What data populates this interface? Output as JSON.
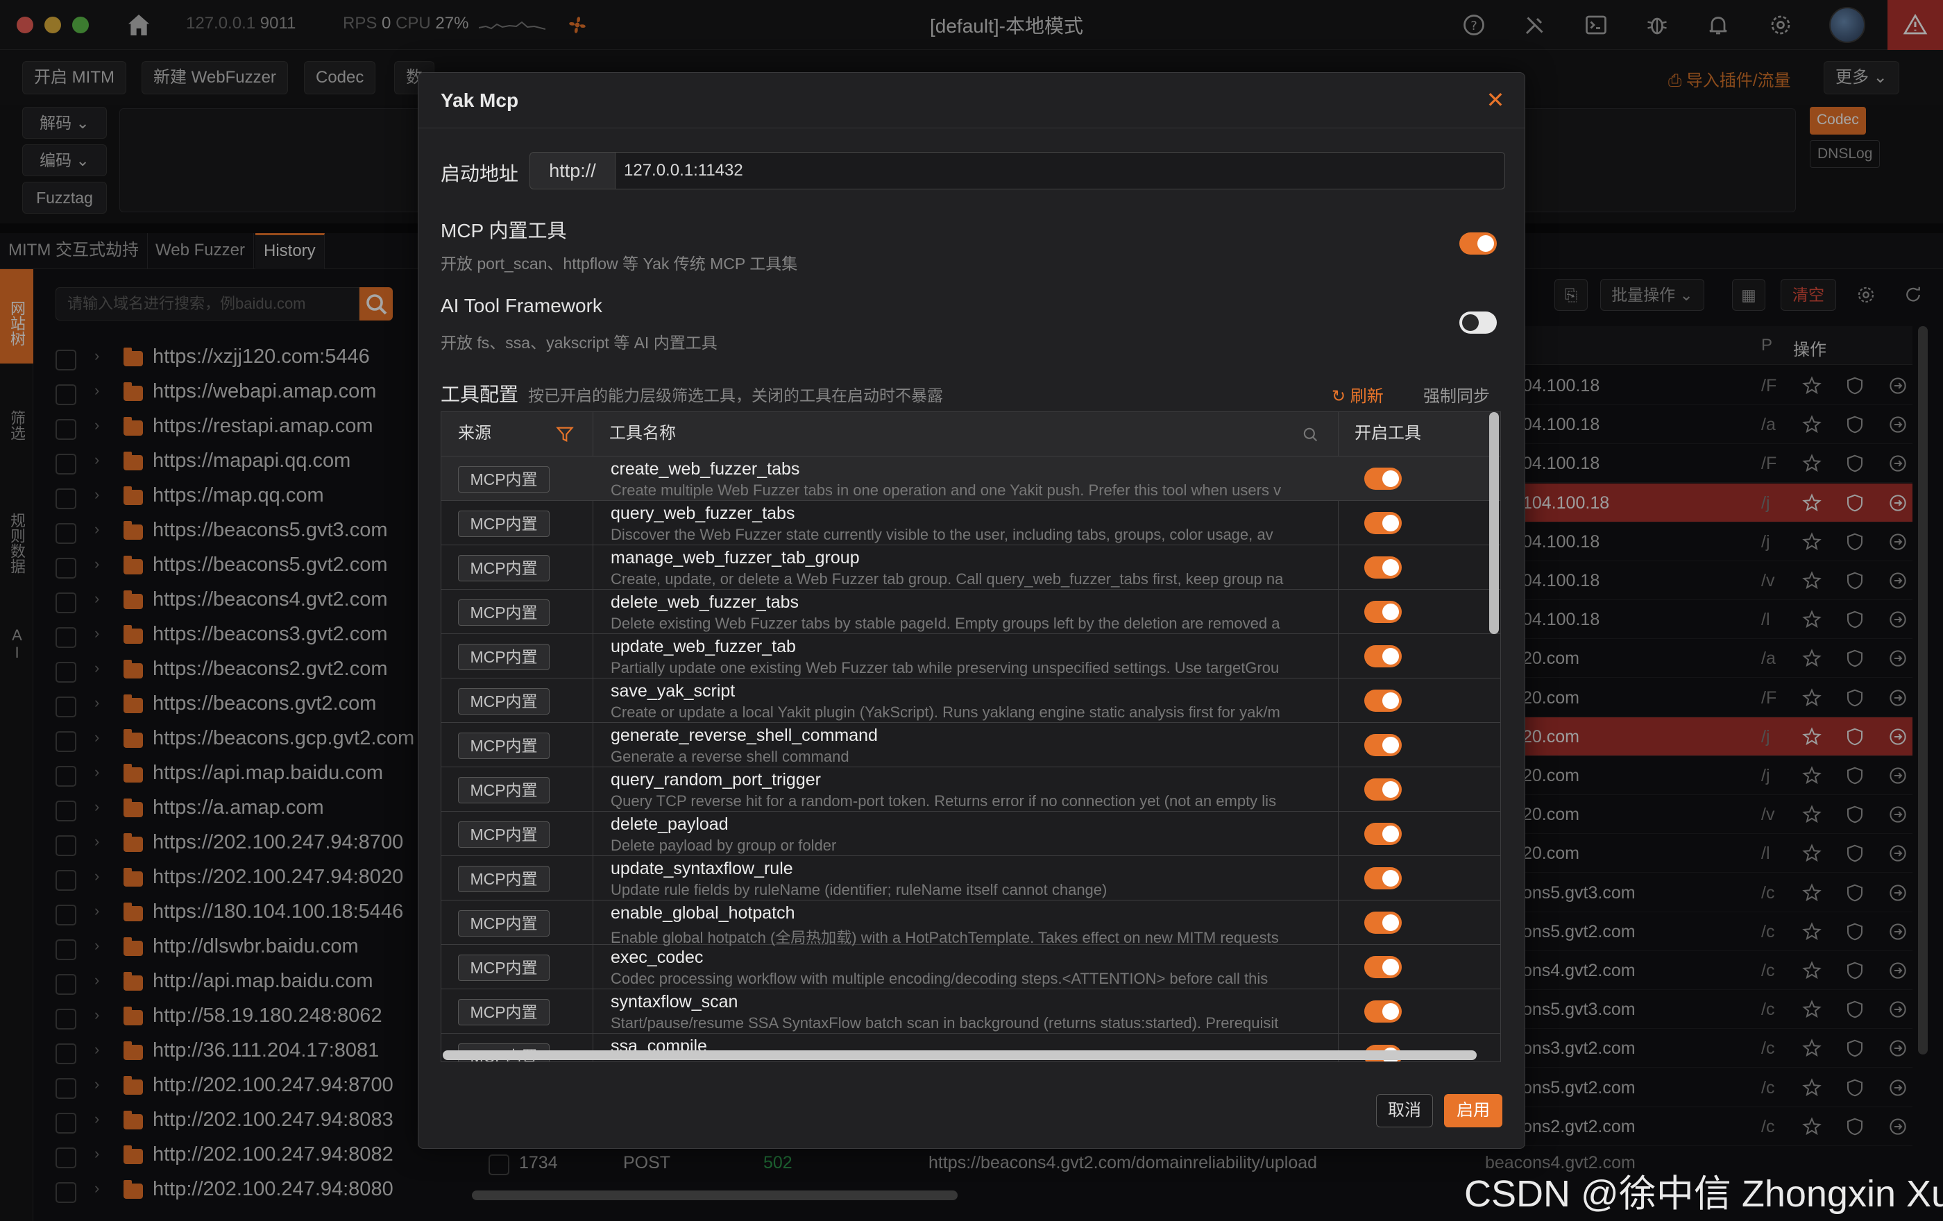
{
  "window": {
    "title": "[default]-本地模式",
    "address": "127.0.0.1",
    "port": "9011",
    "rps_label": "RPS",
    "rps_value": "0",
    "cpu_label": "CPU",
    "cpu_value": "27%"
  },
  "toolbar": {
    "buttons": [
      "开启 MITM",
      "新建 WebFuzzer",
      "Codec",
      "数"
    ],
    "import_label": "导入插件/流量",
    "more_label": "更多"
  },
  "codec": {
    "decode_label": "解码",
    "encode_label": "编码",
    "fuzztag_label": "Fuzztag",
    "right_tabs": [
      "Codec",
      "DNSLog"
    ]
  },
  "tabs": [
    "MITM 交互式劫持",
    "Web Fuzzer",
    "History"
  ],
  "left_rail": [
    "网站树",
    "筛选",
    "规则数据",
    "AI"
  ],
  "site_tree": {
    "search_placeholder": "请输入域名进行搜索，例baidu.com",
    "items": [
      "https://xzjj120.com:5446",
      "https://webapi.amap.com",
      "https://restapi.amap.com",
      "https://mapapi.qq.com",
      "https://map.qq.com",
      "https://beacons5.gvt3.com",
      "https://beacons5.gvt2.com",
      "https://beacons4.gvt2.com",
      "https://beacons3.gvt2.com",
      "https://beacons2.gvt2.com",
      "https://beacons.gvt2.com",
      "https://beacons.gcp.gvt2.com",
      "https://api.map.baidu.com",
      "https://a.amap.com",
      "https://202.100.247.94:8700",
      "https://202.100.247.94:8020",
      "https://180.104.100.18:5446",
      "http://dlswbr.baidu.com",
      "http://api.map.baidu.com",
      "http://58.19.180.248:8062",
      "http://36.111.204.17:8081",
      "http://202.100.247.94:8700",
      "http://202.100.247.94:8083",
      "http://202.100.247.94:8082",
      "http://202.100.247.94:8080"
    ]
  },
  "history": {
    "batch_label": "批量操作",
    "clear_label": "清空",
    "col_p": "P",
    "col_ops": "操作",
    "rows": [
      {
        "host": "04.100.18",
        "path": "/F",
        "hl": false
      },
      {
        "host": "04.100.18",
        "path": "/a",
        "hl": false
      },
      {
        "host": "04.100.18",
        "path": "/F",
        "hl": false
      },
      {
        "host": "104.100.18",
        "path": "/j",
        "hl": true
      },
      {
        "host": "04.100.18",
        "path": "/j",
        "hl": false
      },
      {
        "host": "04.100.18",
        "path": "/v",
        "hl": false
      },
      {
        "host": "04.100.18",
        "path": "/l",
        "hl": false
      },
      {
        "host": "20.com",
        "path": "/a",
        "hl": false
      },
      {
        "host": "20.com",
        "path": "/F",
        "hl": false
      },
      {
        "host": "20.com",
        "path": "/j",
        "hl": true
      },
      {
        "host": "20.com",
        "path": "/j",
        "hl": false
      },
      {
        "host": "20.com",
        "path": "/v",
        "hl": false
      },
      {
        "host": "20.com",
        "path": "/l",
        "hl": false
      },
      {
        "host": "ons5.gvt3.com",
        "path": "/c",
        "hl": false
      },
      {
        "host": "ons5.gvt2.com",
        "path": "/c",
        "hl": false
      },
      {
        "host": "ons4.gvt2.com",
        "path": "/c",
        "hl": false
      },
      {
        "host": "ons5.gvt3.com",
        "path": "/c",
        "hl": false
      },
      {
        "host": "ons3.gvt2.com",
        "path": "/c",
        "hl": false
      },
      {
        "host": "ons5.gvt2.com",
        "path": "/c",
        "hl": false
      },
      {
        "host": "ons2.gvt2.com",
        "path": "/c",
        "hl": false
      }
    ],
    "bottom_row": {
      "id": "1734",
      "method": "POST",
      "status": "502",
      "url": "https://beacons4.gvt2.com/domainreliability/upload",
      "host": "beacons4.gvt2.com"
    }
  },
  "modal": {
    "title": "Yak Mcp",
    "address_label": "启动地址",
    "address_prefix": "http://",
    "address_value": "127.0.0.1:11432",
    "builtin_title": "MCP 内置工具",
    "builtin_desc": "开放 port_scan、httpflow 等 Yak 传统 MCP 工具集",
    "builtin_enabled": true,
    "ai_title": "AI Tool Framework",
    "ai_desc": "开放 fs、ssa、yakscript 等 AI 内置工具",
    "ai_enabled": false,
    "config_title": "工具配置",
    "config_desc": "按已开启的能力层级筛选工具，关闭的工具在启动时不暴露",
    "refresh_label": "刷新",
    "sync_label": "强制同步",
    "col_source": "来源",
    "col_name": "工具名称",
    "col_enable": "开启工具",
    "cancel_label": "取消",
    "ok_label": "启用",
    "tools": [
      {
        "source": "MCP内置",
        "name": "create_web_fuzzer_tabs",
        "desc": "Create multiple Web Fuzzer tabs in one operation and one Yakit push. Prefer this tool when users v",
        "enabled": true
      },
      {
        "source": "MCP内置",
        "name": "query_web_fuzzer_tabs",
        "desc": "Discover the Web Fuzzer state currently visible to the user, including tabs, groups, color usage, av",
        "enabled": true
      },
      {
        "source": "MCP内置",
        "name": "manage_web_fuzzer_tab_group",
        "desc": "Create, update, or delete a Web Fuzzer tab group. Call query_web_fuzzer_tabs first, keep group na",
        "enabled": true
      },
      {
        "source": "MCP内置",
        "name": "delete_web_fuzzer_tabs",
        "desc": "Delete existing Web Fuzzer tabs by stable pageId. Empty groups left by the deletion are removed a",
        "enabled": true
      },
      {
        "source": "MCP内置",
        "name": "update_web_fuzzer_tab",
        "desc": "Partially update one existing Web Fuzzer tab while preserving unspecified settings. Use targetGrou",
        "enabled": true
      },
      {
        "source": "MCP内置",
        "name": "save_yak_script",
        "desc": "Create or update a local Yakit plugin (YakScript). Runs yaklang engine static analysis first for yak/m",
        "enabled": true
      },
      {
        "source": "MCP内置",
        "name": "generate_reverse_shell_command",
        "desc": "Generate a reverse shell command",
        "enabled": true
      },
      {
        "source": "MCP内置",
        "name": "query_random_port_trigger",
        "desc": "Query TCP reverse hit for a random-port token. Returns error if no connection yet (not an empty lis",
        "enabled": true
      },
      {
        "source": "MCP内置",
        "name": "delete_payload",
        "desc": "Delete payload by group or folder",
        "enabled": true
      },
      {
        "source": "MCP内置",
        "name": "update_syntaxflow_rule",
        "desc": "Update rule fields by ruleName (identifier; ruleName itself cannot change)",
        "enabled": true
      },
      {
        "source": "MCP内置",
        "name": "enable_global_hotpatch",
        "desc": "Enable global hotpatch (全局热加载) with a HotPatchTemplate. Takes effect on new MITM requests",
        "enabled": true
      },
      {
        "source": "MCP内置",
        "name": "exec_codec",
        "desc": "Codec processing workflow with multiple encoding/decoding steps.<ATTENTION> before call this",
        "enabled": true
      },
      {
        "source": "MCP内置",
        "name": "syntaxflow_scan",
        "desc": "Start/pause/resume SSA SyntaxFlow batch scan in background (returns status:started). Prerequisit",
        "enabled": true
      },
      {
        "source": "MCP内置",
        "name": "ssa_compile",
        "desc": "",
        "enabled": true
      }
    ]
  },
  "watermark": "CSDN @徐中信 Zhongxin Xu",
  "colors": {
    "accent": "#e8742a",
    "highlight_row": "#a3302c",
    "alert": "#b3342f"
  }
}
